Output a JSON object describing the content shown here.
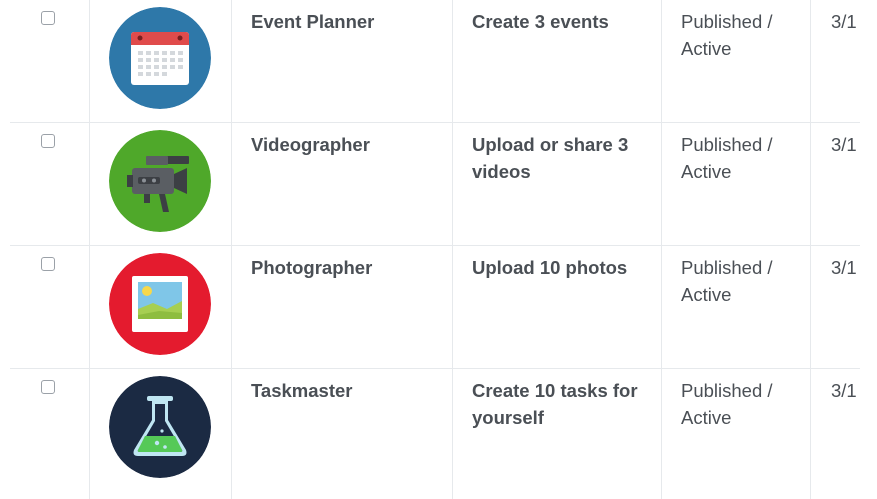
{
  "rows": [
    {
      "name": "Event Planner",
      "criteria": "Create 3 events",
      "status": "Published / Active",
      "date": "3/1",
      "icon": "calendar-icon",
      "badge_color": "#2e78a9"
    },
    {
      "name": "Videographer",
      "criteria": "Upload or share 3 videos",
      "status": "Published / Active",
      "date": "3/1",
      "icon": "video-camera-icon",
      "badge_color": "#4fa82a"
    },
    {
      "name": "Photographer",
      "criteria": "Upload 10 photos",
      "status": "Published / Active",
      "date": "3/1",
      "icon": "photo-icon",
      "badge_color": "#e41b2e"
    },
    {
      "name": "Taskmaster",
      "criteria": "Create 10 tasks for yourself",
      "status": "Published / Active",
      "date": "3/1",
      "icon": "flask-icon",
      "badge_color": "#1b2a43"
    }
  ]
}
